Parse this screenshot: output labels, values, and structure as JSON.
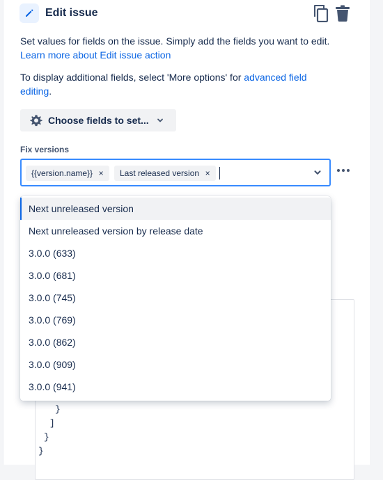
{
  "header": {
    "title": "Edit issue",
    "icon": "pencil-icon",
    "actions": [
      "copy-icon",
      "trash-icon"
    ]
  },
  "description": {
    "line1_text": "Set values for fields on the issue. Simply add the fields you want to edit.",
    "line1_link": "Learn more about Edit issue action",
    "line2_text": "To display additional fields, select 'More options' for",
    "line2_link": "advanced field editing",
    "line2_end": "."
  },
  "choose_fields": {
    "label": "Choose fields to set...",
    "icon": "gear-icon"
  },
  "fix_versions": {
    "label": "Fix versions",
    "tags": [
      "{{version.name}}",
      "Last released version"
    ],
    "remove_glyph": "×"
  },
  "dropdown": {
    "options": [
      "Next unreleased version",
      "Next unreleased version by release date",
      "3.0.0 (633)",
      "3.0.0 (681)",
      "3.0.0 (745)",
      "3.0.0 (769)",
      "3.0.0 (862)",
      "3.0.0 (909)",
      "3.0.0 (941)"
    ],
    "highlighted_index": 0
  },
  "code": {
    "lines": [
      "}",
      "]",
      "}",
      "}"
    ]
  },
  "colors": {
    "accent": "#0c66e4",
    "focus_border": "#388bff",
    "text": "#172b4d"
  }
}
